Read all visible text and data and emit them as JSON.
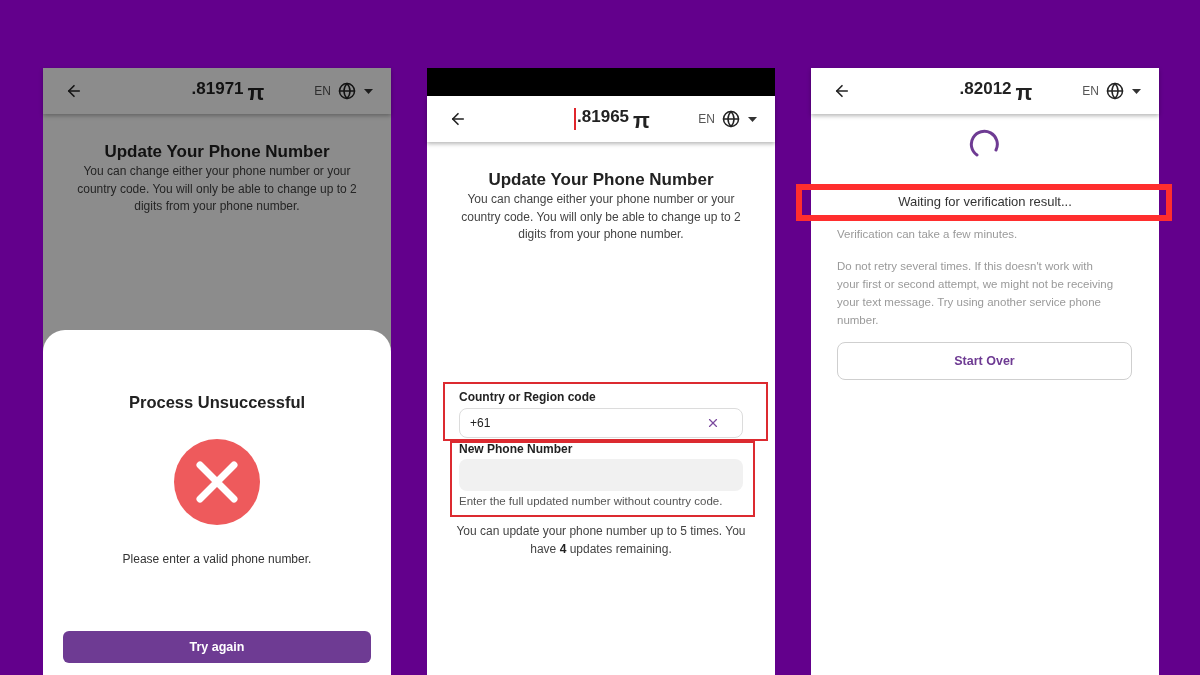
{
  "screens": [
    {
      "kind": "error_dialog",
      "dimmed": true,
      "status_bar": false,
      "header": {
        "balance": ".81971",
        "currency": "π",
        "language": "EN",
        "text_cursor": false
      },
      "title": "Update Your Phone Number",
      "description": "You can change either your phone number or your country code. You will only be able to change up to 2 digits from your phone number.",
      "dialog": {
        "title": "Process Unsuccessful",
        "message": "Please enter a valid phone number.",
        "button": "Try again"
      }
    },
    {
      "kind": "phone_form",
      "dimmed": false,
      "status_bar": true,
      "header": {
        "balance": ".81965",
        "currency": "π",
        "language": "EN",
        "text_cursor": true
      },
      "title": "Update Your Phone Number",
      "description": "You can change either your phone number or your country code. You will only be able to change up to 2 digits from your phone number.",
      "country_field": {
        "label": "Country or Region code",
        "value": "+61",
        "highlighted": true
      },
      "phone_field": {
        "label": "New Phone Number",
        "hint": "Enter the full updated number without country code.",
        "highlighted": true
      },
      "note": "You can update your phone number up to 5 times. You have **4** updates remaining."
    },
    {
      "kind": "verification_wait",
      "dimmed": false,
      "status_bar": false,
      "header": {
        "balance": ".82012",
        "currency": "π",
        "language": "EN",
        "text_cursor": false
      },
      "status": {
        "text": "Waiting for verification result...",
        "highlighted": true
      },
      "subtitle": "Verification can take a few minutes.",
      "advice": "Do not retry several times. If this doesn't work with your first or second attempt, we might not be receiving your text message. Try using another service phone number.",
      "button": "Start Over"
    }
  ]
}
